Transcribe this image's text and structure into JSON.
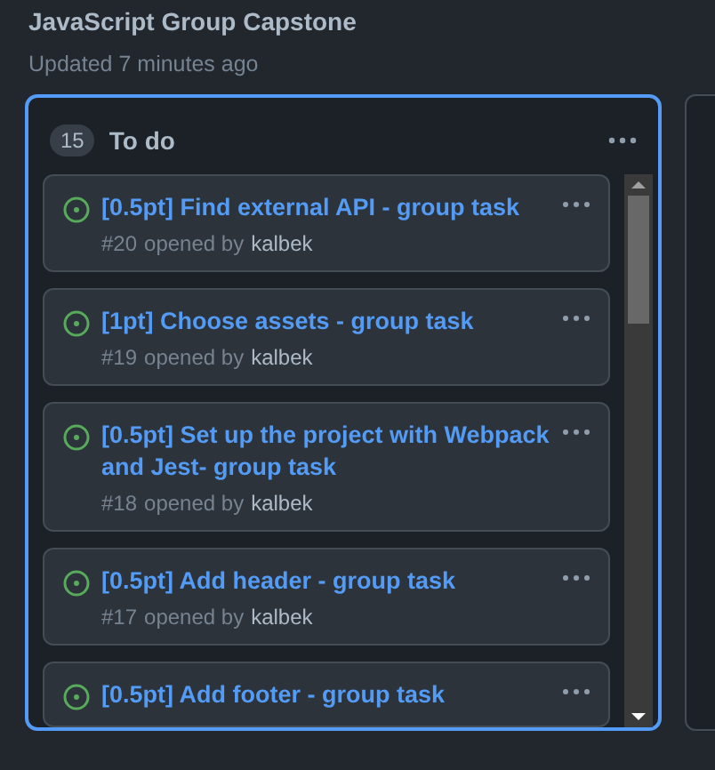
{
  "project": {
    "title": "JavaScript Group Capstone",
    "updated": "Updated 7 minutes ago"
  },
  "column": {
    "count": "15",
    "name": "To do",
    "selected": true,
    "cards": [
      {
        "title": "[0.5pt] Find external API - group task",
        "number": "#20",
        "opened": "opened by",
        "author": "kalbek"
      },
      {
        "title": "[1pt] Choose assets - group task",
        "number": "#19",
        "opened": "opened by",
        "author": "kalbek"
      },
      {
        "title": "[0.5pt] Set up the project with Webpack and Jest- group task",
        "number": "#18",
        "opened": "opened by",
        "author": "kalbek"
      },
      {
        "title": "[0.5pt] Add header - group task",
        "number": "#17",
        "opened": "opened by",
        "author": "kalbek"
      },
      {
        "title": "[0.5pt] Add footer - group task"
      }
    ]
  }
}
